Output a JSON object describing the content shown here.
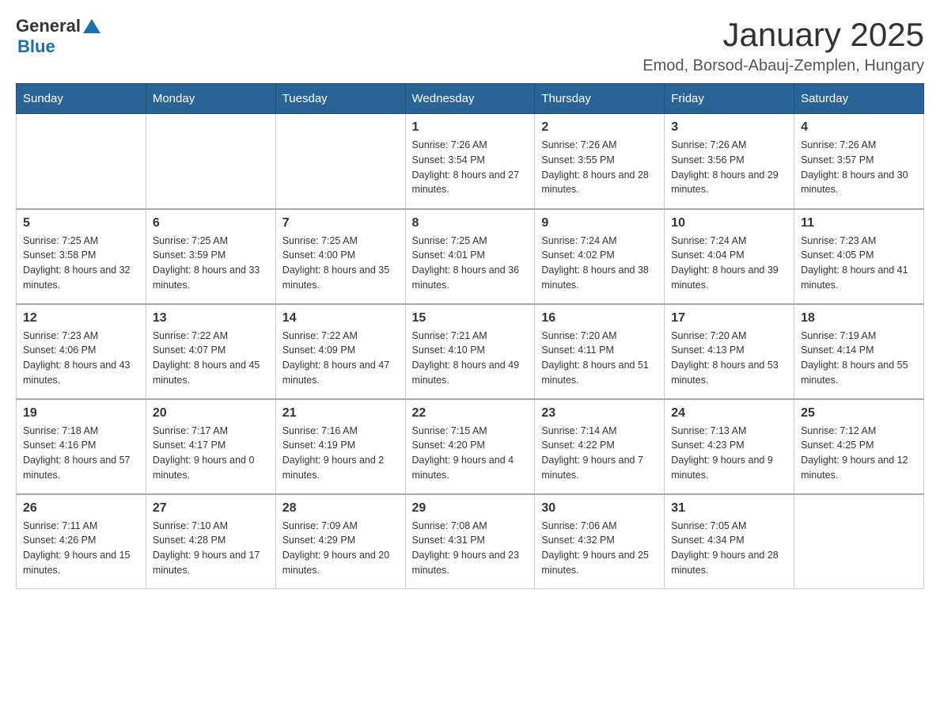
{
  "logo": {
    "general": "General",
    "blue": "Blue"
  },
  "title": {
    "month": "January 2025",
    "location": "Emod, Borsod-Abauj-Zemplen, Hungary"
  },
  "headers": [
    "Sunday",
    "Monday",
    "Tuesday",
    "Wednesday",
    "Thursday",
    "Friday",
    "Saturday"
  ],
  "weeks": [
    [
      {
        "day": "",
        "info": ""
      },
      {
        "day": "",
        "info": ""
      },
      {
        "day": "",
        "info": ""
      },
      {
        "day": "1",
        "info": "Sunrise: 7:26 AM\nSunset: 3:54 PM\nDaylight: 8 hours and 27 minutes."
      },
      {
        "day": "2",
        "info": "Sunrise: 7:26 AM\nSunset: 3:55 PM\nDaylight: 8 hours and 28 minutes."
      },
      {
        "day": "3",
        "info": "Sunrise: 7:26 AM\nSunset: 3:56 PM\nDaylight: 8 hours and 29 minutes."
      },
      {
        "day": "4",
        "info": "Sunrise: 7:26 AM\nSunset: 3:57 PM\nDaylight: 8 hours and 30 minutes."
      }
    ],
    [
      {
        "day": "5",
        "info": "Sunrise: 7:25 AM\nSunset: 3:58 PM\nDaylight: 8 hours and 32 minutes."
      },
      {
        "day": "6",
        "info": "Sunrise: 7:25 AM\nSunset: 3:59 PM\nDaylight: 8 hours and 33 minutes."
      },
      {
        "day": "7",
        "info": "Sunrise: 7:25 AM\nSunset: 4:00 PM\nDaylight: 8 hours and 35 minutes."
      },
      {
        "day": "8",
        "info": "Sunrise: 7:25 AM\nSunset: 4:01 PM\nDaylight: 8 hours and 36 minutes."
      },
      {
        "day": "9",
        "info": "Sunrise: 7:24 AM\nSunset: 4:02 PM\nDaylight: 8 hours and 38 minutes."
      },
      {
        "day": "10",
        "info": "Sunrise: 7:24 AM\nSunset: 4:04 PM\nDaylight: 8 hours and 39 minutes."
      },
      {
        "day": "11",
        "info": "Sunrise: 7:23 AM\nSunset: 4:05 PM\nDaylight: 8 hours and 41 minutes."
      }
    ],
    [
      {
        "day": "12",
        "info": "Sunrise: 7:23 AM\nSunset: 4:06 PM\nDaylight: 8 hours and 43 minutes."
      },
      {
        "day": "13",
        "info": "Sunrise: 7:22 AM\nSunset: 4:07 PM\nDaylight: 8 hours and 45 minutes."
      },
      {
        "day": "14",
        "info": "Sunrise: 7:22 AM\nSunset: 4:09 PM\nDaylight: 8 hours and 47 minutes."
      },
      {
        "day": "15",
        "info": "Sunrise: 7:21 AM\nSunset: 4:10 PM\nDaylight: 8 hours and 49 minutes."
      },
      {
        "day": "16",
        "info": "Sunrise: 7:20 AM\nSunset: 4:11 PM\nDaylight: 8 hours and 51 minutes."
      },
      {
        "day": "17",
        "info": "Sunrise: 7:20 AM\nSunset: 4:13 PM\nDaylight: 8 hours and 53 minutes."
      },
      {
        "day": "18",
        "info": "Sunrise: 7:19 AM\nSunset: 4:14 PM\nDaylight: 8 hours and 55 minutes."
      }
    ],
    [
      {
        "day": "19",
        "info": "Sunrise: 7:18 AM\nSunset: 4:16 PM\nDaylight: 8 hours and 57 minutes."
      },
      {
        "day": "20",
        "info": "Sunrise: 7:17 AM\nSunset: 4:17 PM\nDaylight: 9 hours and 0 minutes."
      },
      {
        "day": "21",
        "info": "Sunrise: 7:16 AM\nSunset: 4:19 PM\nDaylight: 9 hours and 2 minutes."
      },
      {
        "day": "22",
        "info": "Sunrise: 7:15 AM\nSunset: 4:20 PM\nDaylight: 9 hours and 4 minutes."
      },
      {
        "day": "23",
        "info": "Sunrise: 7:14 AM\nSunset: 4:22 PM\nDaylight: 9 hours and 7 minutes."
      },
      {
        "day": "24",
        "info": "Sunrise: 7:13 AM\nSunset: 4:23 PM\nDaylight: 9 hours and 9 minutes."
      },
      {
        "day": "25",
        "info": "Sunrise: 7:12 AM\nSunset: 4:25 PM\nDaylight: 9 hours and 12 minutes."
      }
    ],
    [
      {
        "day": "26",
        "info": "Sunrise: 7:11 AM\nSunset: 4:26 PM\nDaylight: 9 hours and 15 minutes."
      },
      {
        "day": "27",
        "info": "Sunrise: 7:10 AM\nSunset: 4:28 PM\nDaylight: 9 hours and 17 minutes."
      },
      {
        "day": "28",
        "info": "Sunrise: 7:09 AM\nSunset: 4:29 PM\nDaylight: 9 hours and 20 minutes."
      },
      {
        "day": "29",
        "info": "Sunrise: 7:08 AM\nSunset: 4:31 PM\nDaylight: 9 hours and 23 minutes."
      },
      {
        "day": "30",
        "info": "Sunrise: 7:06 AM\nSunset: 4:32 PM\nDaylight: 9 hours and 25 minutes."
      },
      {
        "day": "31",
        "info": "Sunrise: 7:05 AM\nSunset: 4:34 PM\nDaylight: 9 hours and 28 minutes."
      },
      {
        "day": "",
        "info": ""
      }
    ]
  ]
}
